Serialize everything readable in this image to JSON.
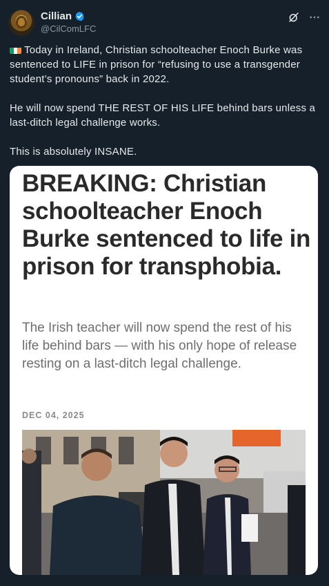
{
  "author": {
    "display_name": "Cillian",
    "handle": "@CilComLFC",
    "verified": true,
    "avatar_icon": "lion-avatar"
  },
  "actions": {
    "grok_icon": "grok-icon",
    "more_icon": "more-icon"
  },
  "post": {
    "flag_icon": "ireland-flag-icon",
    "paragraph1": "Today in Ireland, Christian schoolteacher Enoch Burke was sentenced to LIFE in prison for “refusing to use a transgender student’s pronouns” back in 2022.",
    "paragraph2": "He will now spend THE REST OF HIS LIFE behind bars unless a last-ditch legal challenge works.",
    "paragraph3": "This is absolutely INSANE."
  },
  "media": {
    "headline": "BREAKING: Christian schoolteacher Enoch Burke sentenced to life in prison for transphobia.",
    "subhead": "The Irish teacher will now spend the rest of his life behind bars — with his only hope of release resting on a last-ditch legal challenge.",
    "date": "DEC 04, 2025",
    "photo_description_icon": "news-photo"
  },
  "colors": {
    "background": "#15202b",
    "text": "#e7e9ea",
    "secondary_text": "#8b98a5",
    "verified_blue": "#1d9bf0"
  }
}
